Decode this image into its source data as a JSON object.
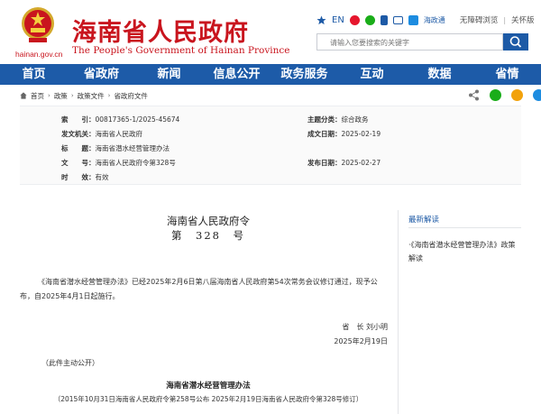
{
  "header": {
    "cn_title": "海南省人民政府",
    "en_title": "The People's Government of Hainan Province",
    "site_url": "hainan.gov.cn",
    "lang_en": "EN",
    "haizheng": "海政通",
    "wuzhangai": "无障碍浏览",
    "separator": "|",
    "care_mode": "关怀版",
    "search_placeholder": "请输入您要搜索的关键字",
    "icons": [
      "star-icon",
      "weibo-icon",
      "wechat-icon",
      "app-icon",
      "email-icon",
      "haizheng-icon",
      "search-icon"
    ]
  },
  "nav": [
    "首页",
    "省政府",
    "新闻",
    "信息公开",
    "政务服务",
    "互动",
    "数据",
    "省情"
  ],
  "breadcrumb": [
    "首页",
    "政策",
    "政策文件",
    "省政府文件"
  ],
  "breadcrumb_sep": "›",
  "share_icons": [
    "share-icon",
    "wechat-share-icon",
    "weibo-share-icon",
    "qq-share-icon"
  ],
  "info": {
    "index_label": "索　　引：",
    "index_value": "00817365-1/2025-45674",
    "category_label": "主题分类：",
    "category_value": "综合政务",
    "issuer_label": "发文机关：",
    "issuer_value": "海南省人民政府",
    "created_label": "成文日期：",
    "created_value": "2025-02-19",
    "title_label": "标　　题：",
    "title_value": "海南省潜水经营管理办法",
    "docno_label": "文　　号：",
    "docno_value": "海南省人民政府令第328号",
    "published_label": "发布日期：",
    "published_value": "2025-02-27",
    "validity_label": "时　　效：",
    "validity_value": "有效"
  },
  "doc": {
    "title": "海南省人民政府令",
    "number": "第　328　号",
    "paragraph": "《海南省潜水经营管理办法》已经2025年2月6日第八届海南省人民政府第54次常务会议修订通过，现予公布，自2025年4月1日起施行。",
    "signer": "省　长  刘小明",
    "date": "2025年2月19日",
    "public_note": "（此件主动公开）",
    "law_title": "海南省潜水经营管理办法",
    "law_subtitle": "（2015年10月31日海南省人民政府令第258号公布  2025年2月19日海南省人民政府令第328号修订）"
  },
  "sidebar": {
    "title": "最新解读",
    "item": "·《海南省潜水经营管理办法》政策解读"
  },
  "colors": {
    "brand_red": "#c9151e",
    "nav_blue": "#1d5ba8",
    "link_blue": "#1d5aa6"
  }
}
